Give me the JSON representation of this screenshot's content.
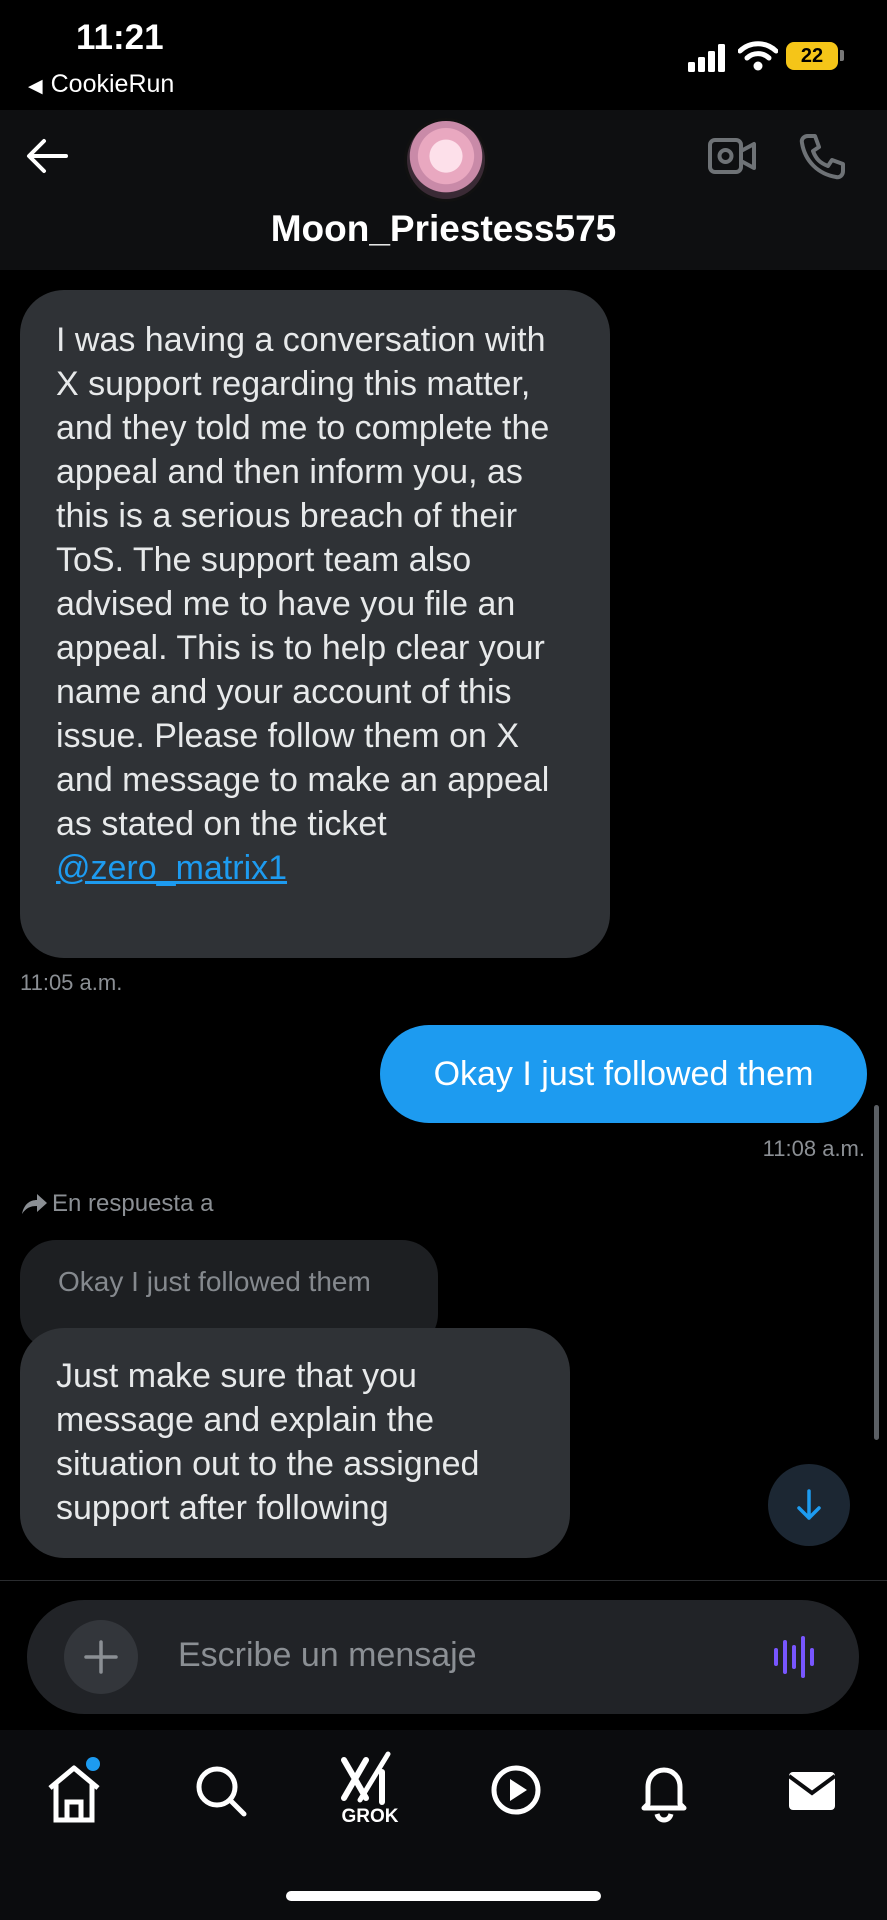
{
  "status_bar": {
    "time": "11:21",
    "back_app": "CookieRun",
    "battery": "22"
  },
  "header": {
    "username": "Moon_Priestess575",
    "icons": [
      "back-arrow-icon",
      "video-call-icon",
      "phone-icon"
    ]
  },
  "messages": [
    {
      "direction": "incoming",
      "text": "I was having a conversation with X support regarding this matter, and they told me to complete the appeal and then inform you, as this is a serious breach of their ToS. The support team also advised me to have you file an appeal. This is to help clear your name and your account of this issue. Please follow them on X and message to make an appeal as stated on the ticket",
      "mention": "@zero_matrix1",
      "timestamp": "11:05 a.m."
    },
    {
      "direction": "outgoing",
      "text": "Okay I just followed them",
      "timestamp": "11:08 a.m."
    },
    {
      "direction": "incoming",
      "reply_label": "En respuesta a",
      "quoted": "Okay I just followed them",
      "text": "Just make sure that you message and explain the situation out to the assigned support after following"
    }
  ],
  "composer": {
    "placeholder": "Escribe un mensaje"
  },
  "nav": {
    "items": [
      "home-icon",
      "search-icon",
      "grok-icon",
      "video-icon",
      "notifications-icon",
      "messages-icon"
    ],
    "grok_label": "GROK"
  },
  "colors": {
    "accent": "#1d9bf0",
    "incoming_bubble": "#2f3236",
    "voice_icon": "#7856ff",
    "battery": "#f5c518"
  }
}
